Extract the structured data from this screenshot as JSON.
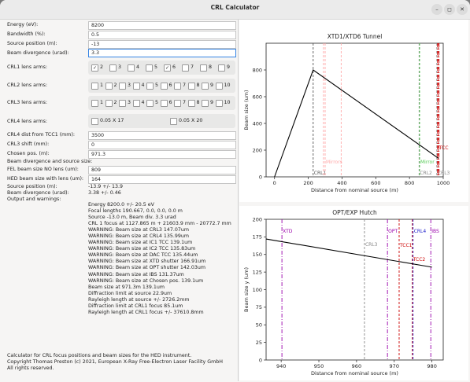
{
  "window": {
    "title": "CRL Calculator",
    "min": "–",
    "max": "◻",
    "close": "✕"
  },
  "fields": [
    {
      "label": "Energy (eV):",
      "value": "8200"
    },
    {
      "label": "Bandwidth (%):",
      "value": "0.5"
    },
    {
      "label": "Source position (m):",
      "value": "-13"
    },
    {
      "label": "Beam divergence (urad):",
      "value": "3.3"
    }
  ],
  "crl1": {
    "label": "CRL1 lens arms:",
    "arms": [
      {
        "n": "2",
        "checked": true
      },
      {
        "n": "3",
        "checked": false
      },
      {
        "n": "4",
        "checked": false
      },
      {
        "n": "5",
        "checked": false
      },
      {
        "n": "6",
        "checked": true
      },
      {
        "n": "7",
        "checked": false
      },
      {
        "n": "8",
        "checked": false
      },
      {
        "n": "9",
        "checked": false
      }
    ]
  },
  "crl2": {
    "label": "CRL2 lens arms:",
    "arms": [
      "1",
      "2",
      "3",
      "4",
      "5",
      "6",
      "7",
      "8",
      "9",
      "10"
    ]
  },
  "crl3": {
    "label": "CRL3 lens arms:",
    "arms": [
      "1",
      "2",
      "3",
      "4",
      "5",
      "6",
      "7",
      "8",
      "9",
      "10"
    ]
  },
  "crl4": {
    "label": "CRL4 lens arms:",
    "arms": [
      "0.05 X 17",
      "0.05 X 20"
    ]
  },
  "fields2": [
    {
      "label": "CRL4 dist from TCC1 (mm):",
      "value": "3500"
    },
    {
      "label": "CRL3 shift (mm):",
      "value": "0"
    },
    {
      "label": "Chosen pos. (m):",
      "value": "971.3"
    }
  ],
  "section_label": "Beam divergence and source size:",
  "fields3": [
    {
      "label": "FEL beam size NO lens (um):",
      "value": "809"
    },
    {
      "label": "HED beam size with lens (um):",
      "value": "164"
    }
  ],
  "source_position": {
    "label": "Source position (m):",
    "value": "-13.9 +/- 13.9"
  },
  "beam_divergence": {
    "label": "Beam divergence (urad):",
    "value": "3.38 +/- 0.46"
  },
  "output_label": "Output and warnings:",
  "output_lines": [
    "Energy 8200.0 +/- 20.5 eV",
    "Focal lengths 190.667, 0.0, 0.0, 0.0 m",
    "Source -13.0 m, Beam div. 3.3 urad",
    "CRL 1 focus at 1127.865 m + 21603.9 mm - 20772.7 mm",
    "WARNING: Beam size at CRL3 147.07um",
    "WARNING: Beam size at CRL4 135.99um",
    "WARNING: Beam size at IC1 TCC 139.1um",
    "WARNING: Beam size at IC2 TCC 135.83um",
    "WARNING: Beam size at DAC TCC 135.44um",
    "WARNING: Beam size at XTD shutter 166.91um",
    "WARNING: Beam size at OPT shutter 142.03um",
    "WARNING: Beam size at IBS 131.37um",
    "WARNING: Beam size at Chosen pos. 139.1um",
    "Beam size at 971.3m 139.1um",
    "Diffraction limit at source 22.9um",
    "Rayleigh length at source +/- 2726.2mm",
    "Diffraction limit at CRL1 focus 85.1um",
    "Rayleigh length at CRL1 focus +/- 37610.8mm"
  ],
  "footer": "Calculator for CRL focus positions and beam sizes for the HED instrument.\nCopyright Thomas Preston (c) 2021, European X-Ray Free-Electron Laser Facility GmbH\nAll rights reserved.",
  "chart_data": [
    {
      "type": "line",
      "title": "XTD1/XTD6 Tunnel",
      "xlabel": "Distance from nominal source (m)",
      "ylabel": "Beam size (um)",
      "xlim": [
        -50,
        1000
      ],
      "ylim": [
        0,
        1000
      ],
      "xticks": [
        0,
        200,
        400,
        600,
        800,
        1000
      ],
      "yticks": [
        0,
        200,
        400,
        600,
        800
      ],
      "series": [
        {
          "x": [
            0,
            229,
            971.3
          ],
          "y": [
            0,
            800,
            139.1
          ],
          "color": "#000000"
        }
      ],
      "markers": [
        {
          "x": 229,
          "label": "CRL1",
          "color": "#555555",
          "style": "dashed"
        },
        {
          "x": 290,
          "label": "",
          "color": "#ffaaaa",
          "style": "dashed"
        },
        {
          "x": 300,
          "label": "Mirrors",
          "color": "#ffaaaa",
          "style": "dashed"
        },
        {
          "x": 395,
          "label": "",
          "color": "#ffaaaa",
          "style": "dashed"
        },
        {
          "x": 857,
          "label": "CRL2",
          "color": "#888888",
          "style": "dashed"
        },
        {
          "x": 860,
          "label": "Mirror",
          "color": "#55cc55",
          "style": "dashed"
        },
        {
          "x": 962,
          "label": "CRL3",
          "color": "#888888",
          "style": "dashed"
        },
        {
          "x": 966,
          "label": "",
          "color": "#cc0000",
          "style": "dashdot"
        },
        {
          "x": 971.3,
          "label": "TCC",
          "color": "#cc0000",
          "style": "dashed"
        },
        {
          "x": 975,
          "label": "",
          "color": "#cc0000",
          "style": "dashdot"
        }
      ]
    },
    {
      "type": "line",
      "title": "OPT/EXP Hutch",
      "xlabel": "Distance from nominal source (m)",
      "ylabel": "Beam size y (um)",
      "xlim": [
        936,
        983
      ],
      "ylim": [
        0,
        200
      ],
      "xticks": [
        940,
        950,
        960,
        970,
        980
      ],
      "yticks": [
        0,
        25,
        50,
        75,
        100,
        125,
        150,
        175,
        200
      ],
      "series": [
        {
          "x": [
            936,
            980
          ],
          "y": [
            172,
            132
          ],
          "color": "#000000"
        }
      ],
      "markers": [
        {
          "x": 940.2,
          "label": "XTD",
          "color": "#9900aa",
          "style": "dashdot"
        },
        {
          "x": 962.1,
          "label": "CRL3",
          "color": "#888888",
          "style": "dashed"
        },
        {
          "x": 968.2,
          "label": "OPT",
          "color": "#9900aa",
          "style": "dashdot"
        },
        {
          "x": 971.3,
          "label": "TCC1",
          "color": "#cc0000",
          "style": "dashed"
        },
        {
          "x": 974.8,
          "label": "TCC2",
          "color": "#cc0000",
          "style": "dashed"
        },
        {
          "x": 975.0,
          "label": "CRL4",
          "color": "#2222cc",
          "style": "dashed"
        },
        {
          "x": 979.7,
          "label": "IBS",
          "color": "#9900aa",
          "style": "dashdot"
        }
      ]
    }
  ]
}
